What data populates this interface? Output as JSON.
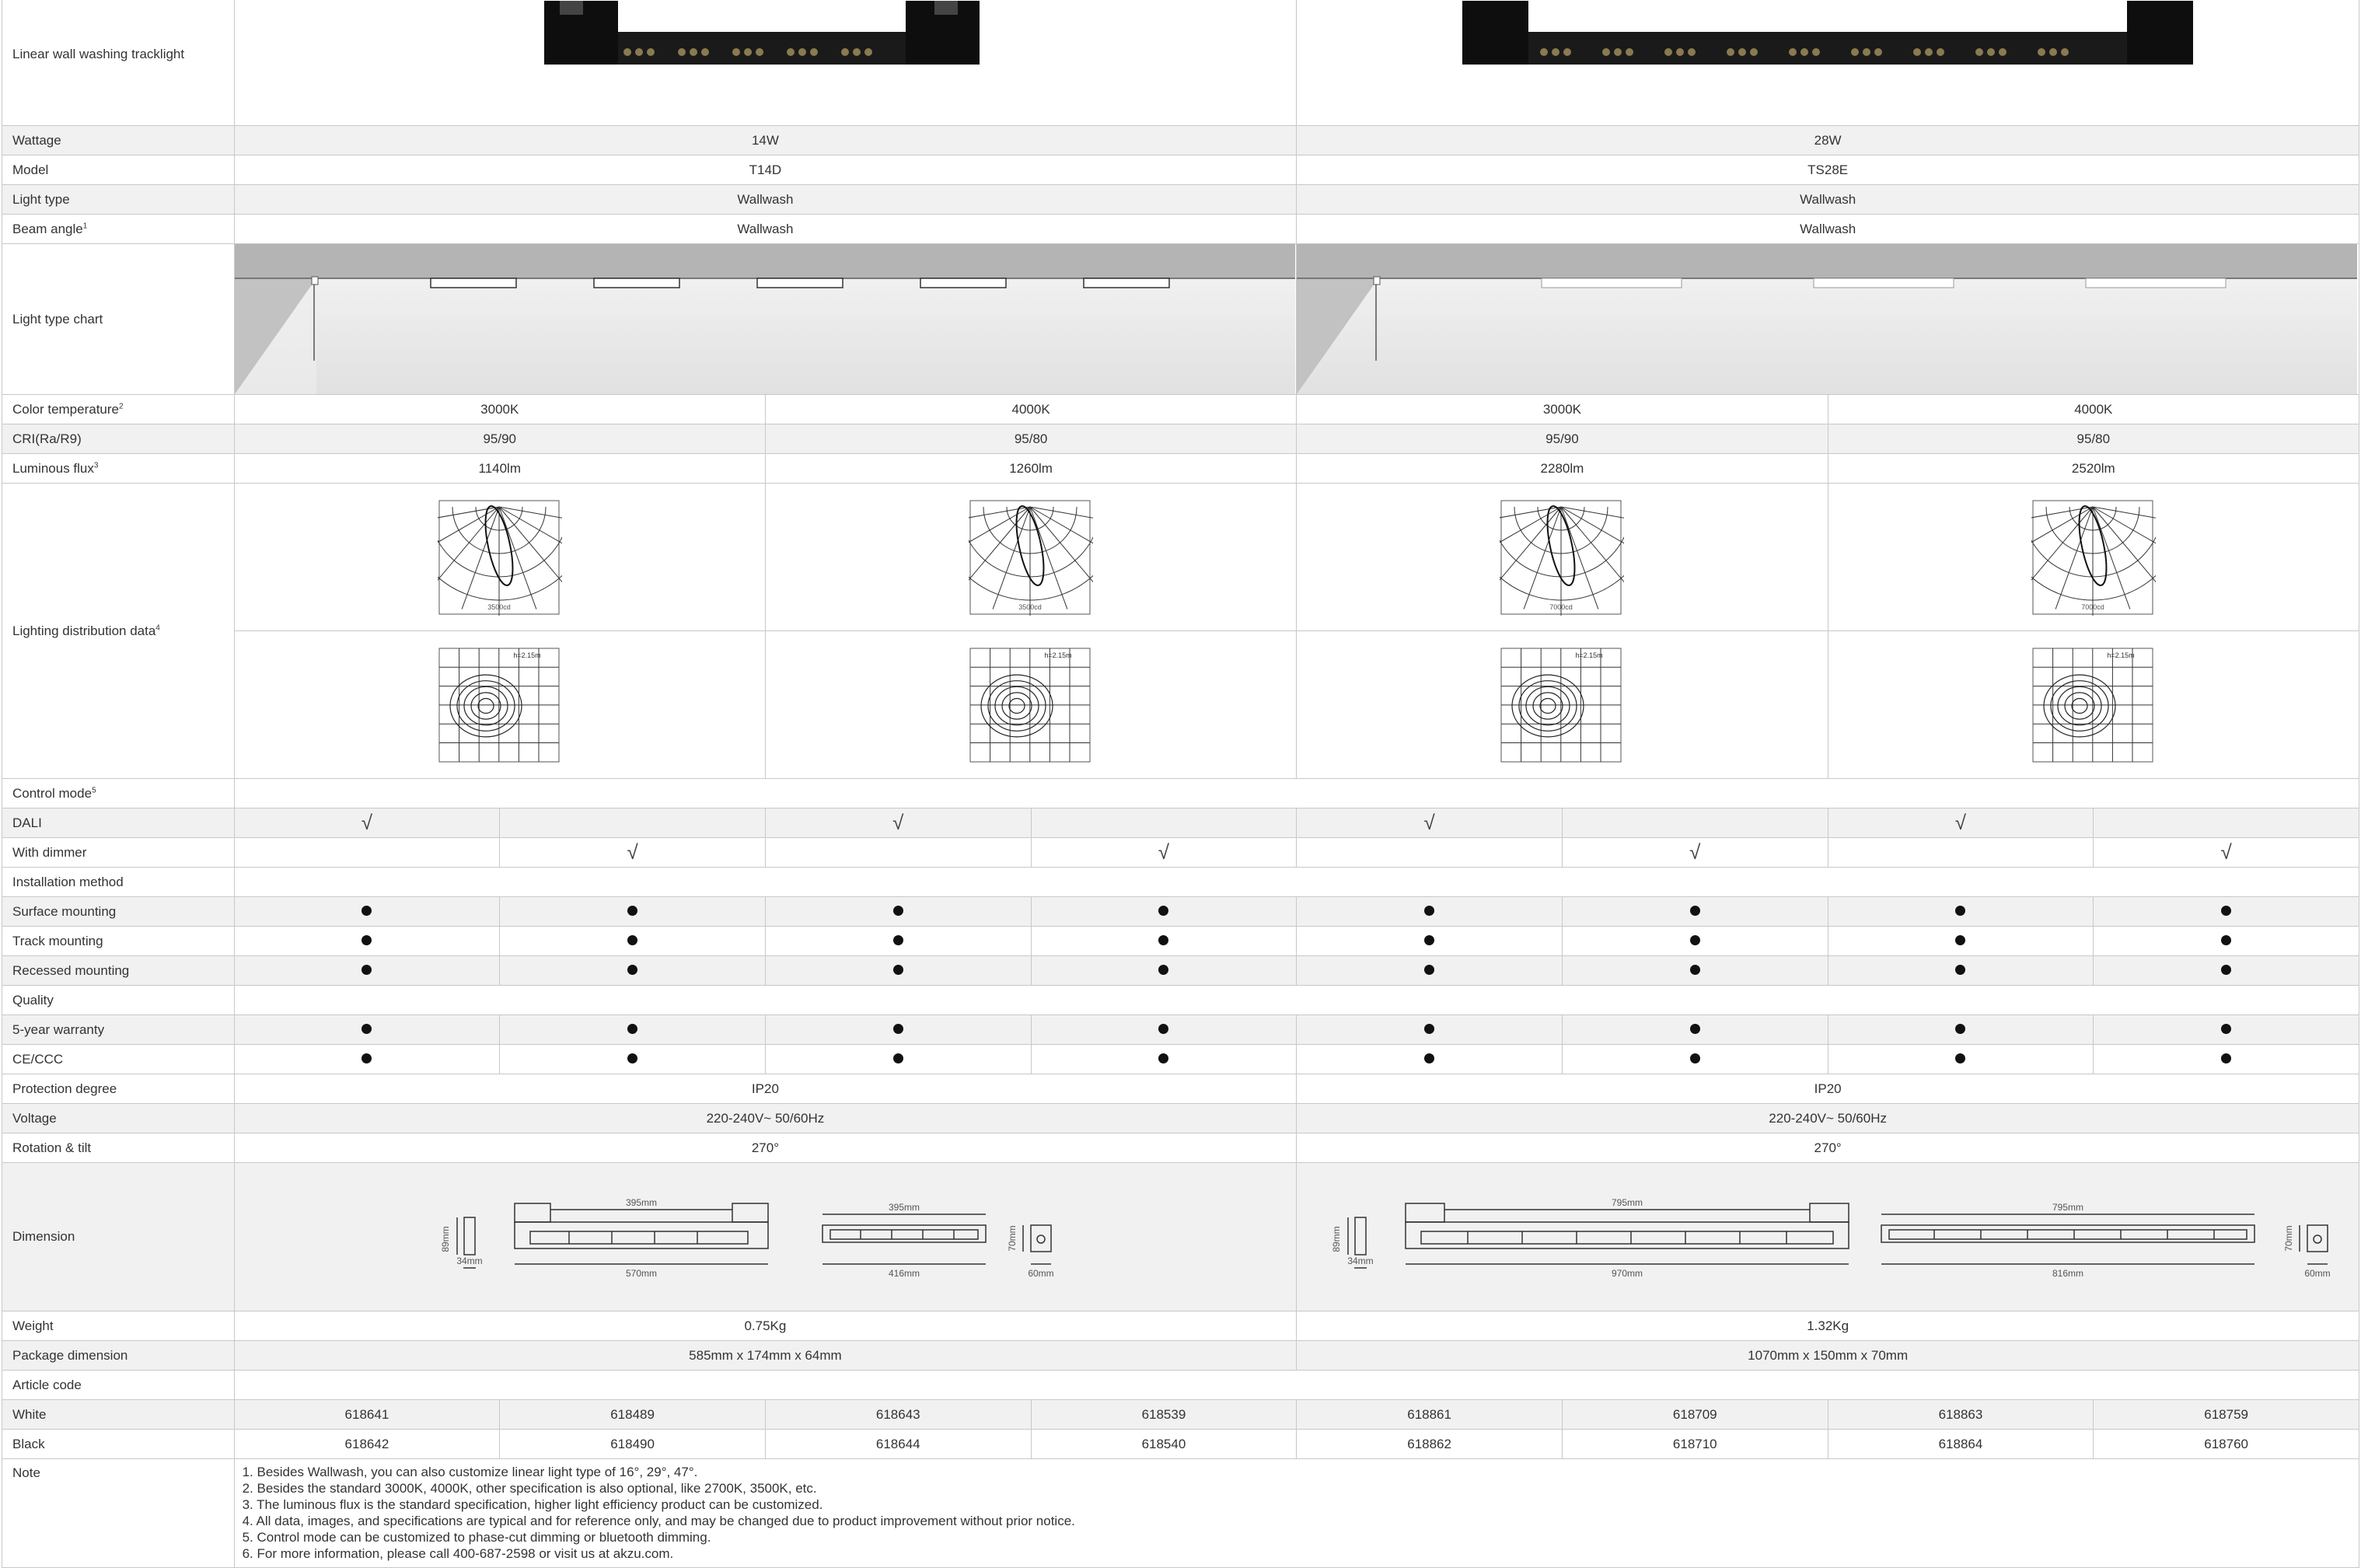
{
  "rows": {
    "product": {
      "label": "Linear wall washing tracklight"
    },
    "wattage": {
      "label": "Wattage",
      "v1": "14W",
      "v2": "28W"
    },
    "model": {
      "label": "Model",
      "v1": "T14D",
      "v2": "TS28E"
    },
    "light_type": {
      "label": "Light type",
      "v1": "Wallwash",
      "v2": "Wallwash"
    },
    "beam_angle": {
      "label": "Beam angle",
      "sup": "1",
      "v1": "Wallwash",
      "v2": "Wallwash"
    },
    "light_type_chart": {
      "label": "Light type chart"
    },
    "color_temp": {
      "label": "Color temperature",
      "sup": "2",
      "values": [
        "3000K",
        "4000K",
        "3000K",
        "4000K"
      ]
    },
    "cri": {
      "label": "CRI(Ra/R9)",
      "values": [
        "95/90",
        "95/80",
        "95/90",
        "95/80"
      ]
    },
    "flux": {
      "label": "Luminous flux",
      "sup": "3",
      "values": [
        "1140lm",
        "1260lm",
        "2280lm",
        "2520lm"
      ]
    },
    "distribution": {
      "label": "Lighting distribution data",
      "sup": "4",
      "polar_labels": [
        "3500cd",
        "3500cd",
        "7000cd",
        "7000cd"
      ],
      "iso_label": "h=2.15m"
    },
    "control_mode": {
      "label": "Control mode",
      "sup": "5"
    },
    "dali": {
      "label": "DALI",
      "mark": "√"
    },
    "dimmer": {
      "label": "With dimmer",
      "mark": "√"
    },
    "installation": {
      "label": "Installation method"
    },
    "surface": {
      "label": "Surface mounting"
    },
    "track": {
      "label": "Track mounting"
    },
    "recessed": {
      "label": "Recessed mounting"
    },
    "quality": {
      "label": "Quality"
    },
    "warranty": {
      "label": "5-year warranty"
    },
    "ce": {
      "label": "CE/CCC"
    },
    "protection": {
      "label": "Protection degree",
      "v1": "IP20",
      "v2": "IP20"
    },
    "voltage": {
      "label": "Voltage",
      "v1": "220-240V~ 50/60Hz",
      "v2": "220-240V~ 50/60Hz"
    },
    "rotation": {
      "label": "Rotation & tilt",
      "v1": "270°",
      "v2": "270°"
    },
    "dimension": {
      "label": "Dimension",
      "p1": {
        "h": "89mm",
        "w": "34mm",
        "top": "395mm",
        "total": "570mm",
        "top2": "395mm",
        "bottom2": "416mm",
        "side_h": "70mm",
        "side_w": "60mm"
      },
      "p2": {
        "h": "89mm",
        "w": "34mm",
        "top": "795mm",
        "total": "970mm",
        "top2": "795mm",
        "bottom2": "816mm",
        "side_h": "70mm",
        "side_w": "60mm"
      }
    },
    "weight": {
      "label": "Weight",
      "v1": "0.75Kg",
      "v2": "1.32Kg"
    },
    "package": {
      "label": "Package dimension",
      "v1": "585mm x 174mm x 64mm",
      "v2": "1070mm x 150mm x 70mm"
    },
    "article": {
      "label": "Article code"
    },
    "white": {
      "label": "White",
      "codes": [
        "618641",
        "618489",
        "618643",
        "618539",
        "618861",
        "618709",
        "618863",
        "618759"
      ]
    },
    "black": {
      "label": "Black",
      "codes": [
        "618642",
        "618490",
        "618644",
        "618540",
        "618862",
        "618710",
        "618864",
        "618760"
      ]
    },
    "note": {
      "label": "Note",
      "lines": [
        "1. Besides Wallwash, you can also customize linear light type of 16°, 29°, 47°.",
        "2. Besides the standard 3000K, 4000K, other specification is also optional, like 2700K, 3500K, etc.",
        "3. The luminous flux is the standard specification, higher light efficiency product can be customized.",
        "4. All data, images, and specifications are typical and for reference only, and may be changed due to product improvement without prior notice.",
        "5. Control mode can be customized to phase-cut dimming or bluetooth dimming.",
        "6. For more information, please call 400-687-2598 or visit us at akzu.com."
      ]
    }
  }
}
